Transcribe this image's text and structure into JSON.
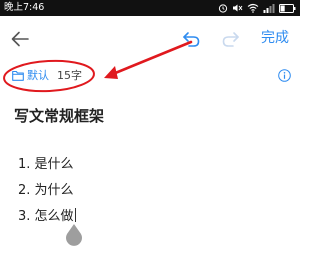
{
  "status_bar": {
    "time": "晚上7:46",
    "battery_level": 0.35
  },
  "toolbar": {
    "back_icon": "arrow-left-icon",
    "undo_icon": "undo-icon",
    "redo_icon": "redo-icon",
    "done_label": "完成",
    "accent_color": "#2f8cf0"
  },
  "meta": {
    "folder_icon": "folder-icon",
    "folder_name": "默认",
    "word_count": "15字",
    "info_icon": "info-icon"
  },
  "note": {
    "title": "写文常规框架",
    "items": [
      "1. 是什么",
      "2. 为什么",
      "3. 怎么做"
    ]
  },
  "annotation_color": "#e0191e"
}
